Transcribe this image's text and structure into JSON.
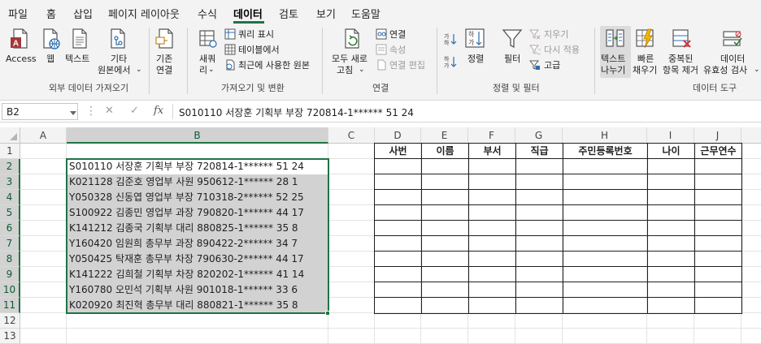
{
  "tabs": [
    {
      "label": "파일",
      "active": false
    },
    {
      "label": "홈",
      "active": false
    },
    {
      "label": "삽입",
      "active": false
    },
    {
      "label": "페이지 레이아웃",
      "active": false
    },
    {
      "label": "수식",
      "active": false
    },
    {
      "label": "데이터",
      "active": true
    },
    {
      "label": "검토",
      "active": false
    },
    {
      "label": "보기",
      "active": false
    },
    {
      "label": "도움말",
      "active": false
    }
  ],
  "ribbon": {
    "external_data": {
      "group_label": "외부 데이터 가져오기",
      "access": "Access",
      "web": "웹",
      "text": "텍스트",
      "other_sources_1": "기타",
      "other_sources_2": "원본에서",
      "existing_conn_1": "기존",
      "existing_conn_2": "연결"
    },
    "get_transform": {
      "group_label": "가져오기 및 변환",
      "new_query_1": "새쿼",
      "new_query_2": "리",
      "show_queries": "쿼리 표시",
      "from_table": "테이블에서",
      "recent_sources": "최근에 사용한 원본"
    },
    "connections": {
      "group_label": "연결",
      "refresh_all_1": "모두 새로",
      "refresh_all_2": "고침",
      "connections": "연결",
      "properties": "속성",
      "edit_links": "연결 편집"
    },
    "sort_filter": {
      "group_label": "정렬 및 필터",
      "sort": "정렬",
      "filter": "필터",
      "clear": "지우기",
      "reapply": "다시 적용",
      "advanced": "고급"
    },
    "data_tools": {
      "group_label": "데이터 도구",
      "text_to_columns_1": "텍스트",
      "text_to_columns_2": "나누기",
      "flash_fill_1": "빠른",
      "flash_fill_2": "채우기",
      "remove_duplicates_1": "중복된",
      "remove_duplicates_2": "항목 제거",
      "data_validation_1": "데이터",
      "data_validation_2": "유효성 검사"
    }
  },
  "formula_bar": {
    "name_box": "B2",
    "fx": "fx",
    "content": "S010110 서장훈 기획부 부장 720814-1****** 51 24"
  },
  "columns": [
    "A",
    "B",
    "C",
    "D",
    "E",
    "F",
    "G",
    "H",
    "I",
    "J"
  ],
  "rows": [
    "1",
    "2",
    "3",
    "4",
    "5",
    "6",
    "7",
    "8",
    "9",
    "10",
    "11",
    "12",
    "13"
  ],
  "table_headers": [
    "사번",
    "이름",
    "부서",
    "직급",
    "주민등록번호",
    "나이",
    "근무연수"
  ],
  "b_column": [
    "S010110 서장훈 기획부 부장 720814-1****** 51 24",
    "K021128 김준호 영업부 사원 950612-1****** 28 1",
    "Y050328 신동엽 영업부 부장 710318-2****** 52 25",
    "S100922 김종민 영업부 과장 790820-1****** 44 17",
    "K141212 김종국 기획부 대리 880825-1****** 35 8",
    "Y160420 임원희 총무부 과장 890422-2****** 34 7",
    "Y050425 탁재훈 총무부 차장 790630-2****** 44 17",
    "K141222 김희철 기획부 차장 820202-1****** 41 14",
    "Y160780 오민석 기획부 사원 901018-1****** 33 6",
    "K020920 최진혁 총무부 대리 880821-1****** 35 8"
  ],
  "colors": {
    "accent": "#217346",
    "selection": "#d2d2d2",
    "ribbon_bg": "#f3f3f3"
  }
}
